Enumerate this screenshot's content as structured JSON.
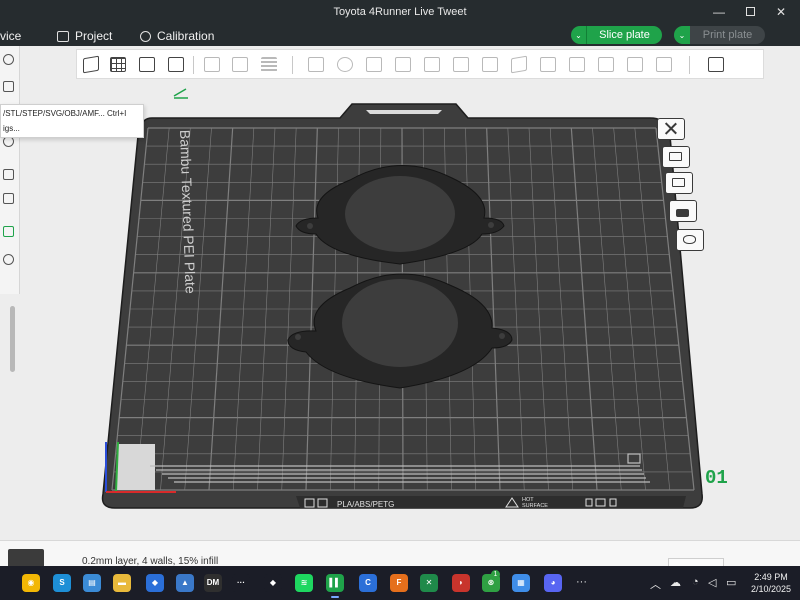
{
  "window": {
    "title": "Toyota 4Runner Live Tweet",
    "minimize_glyph": "—",
    "close_glyph": "✕"
  },
  "menubar": {
    "device": "vice",
    "project": "Project",
    "calibration": "Calibration",
    "slice_button": "Slice plate",
    "print_button": "Print plate",
    "caret_glyph": "⌄"
  },
  "dropdown": {
    "import_label": "/STL/STEP/SVG/OBJ/AMF...",
    "import_shortcut": "Ctrl+I",
    "settings_label": "igs..."
  },
  "plate": {
    "brand_text": "Bambu Textured PEI Plate",
    "material_text": "PLA/ABS/PETG",
    "hot_text": "HOT",
    "surface_text": "SURFACE",
    "plate_number": "01"
  },
  "bottom": {
    "layer_info": "0.2mm layer, 4 walls, 15% infill"
  },
  "taskbar": {
    "clock_time": "2:49 PM",
    "clock_date": "2/10/2025",
    "more_glyph": "···",
    "tray_chevron": "︿",
    "icons": [
      {
        "name": "chrome-icon",
        "color": "#f2b705",
        "glyph": "◉"
      },
      {
        "name": "edge-icon",
        "color": "#1e8fd6",
        "glyph": "S"
      },
      {
        "name": "files-icon",
        "color": "#3b8bd6",
        "glyph": "▤"
      },
      {
        "name": "folder-icon",
        "color": "#e8b93b",
        "glyph": "▬"
      },
      {
        "name": "maps-icon",
        "color": "#2b6fd8",
        "glyph": "◆"
      },
      {
        "name": "triangle-app-icon",
        "color": "#3a78c8",
        "glyph": "▲"
      },
      {
        "name": "dm-app-icon",
        "color": "#2f2f2f",
        "glyph": "DM"
      },
      {
        "name": "dots-app-icon",
        "color": "#1b1d27",
        "glyph": "···"
      },
      {
        "name": "tidal-icon",
        "color": "#1b1d27",
        "glyph": "◆"
      },
      {
        "name": "spotify-icon",
        "color": "#1ed760",
        "glyph": "≋"
      },
      {
        "name": "bambu-studio-icon",
        "color": "#1fa34a",
        "glyph": "▌▌"
      },
      {
        "name": "c-app-icon",
        "color": "#2b6fd8",
        "glyph": "C"
      },
      {
        "name": "f-app-icon",
        "color": "#e56f1c",
        "glyph": "F"
      },
      {
        "name": "excel-icon",
        "color": "#1f8a4a",
        "glyph": "✕"
      },
      {
        "name": "helmet-app-icon",
        "color": "#c8342c",
        "glyph": "◗"
      },
      {
        "name": "xbox-icon",
        "color": "#2fa043",
        "glyph": "⊗"
      },
      {
        "name": "store-icon",
        "color": "#3f8de8",
        "glyph": "▦"
      },
      {
        "name": "discord-icon",
        "color": "#5865f2",
        "glyph": "◕"
      }
    ],
    "xbox_badge": "1"
  },
  "colors": {
    "accent_green": "#1fa34a",
    "plate_dark": "#3d3d3d",
    "grid_line": "#7f7f7f",
    "part_color": "#262626"
  }
}
